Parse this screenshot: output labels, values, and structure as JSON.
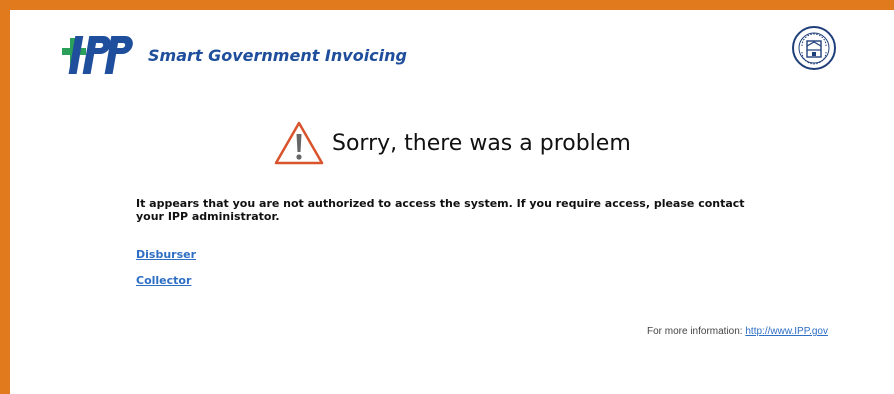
{
  "header": {
    "logo_text": "IPP",
    "tagline": "Smart Government Invoicing",
    "logo_icon": "ipp-logo-icon",
    "seal_icon": "treasury-seal-icon"
  },
  "error": {
    "icon": "warning-triangle-icon",
    "title": "Sorry, there was a problem",
    "message": "It appears that you are not authorized to access the system. If you require access, please contact your IPP administrator."
  },
  "links": {
    "disburser": "Disburser",
    "collector": "Collector"
  },
  "footer": {
    "info_label": "For more information:",
    "info_link": "http://www.IPP.gov"
  },
  "colors": {
    "frame_border": "#e07a1c",
    "brand_blue": "#1f4f9c",
    "brand_green": "#2aa05a",
    "link": "#2e6fc4",
    "warning": "#d9532c"
  }
}
